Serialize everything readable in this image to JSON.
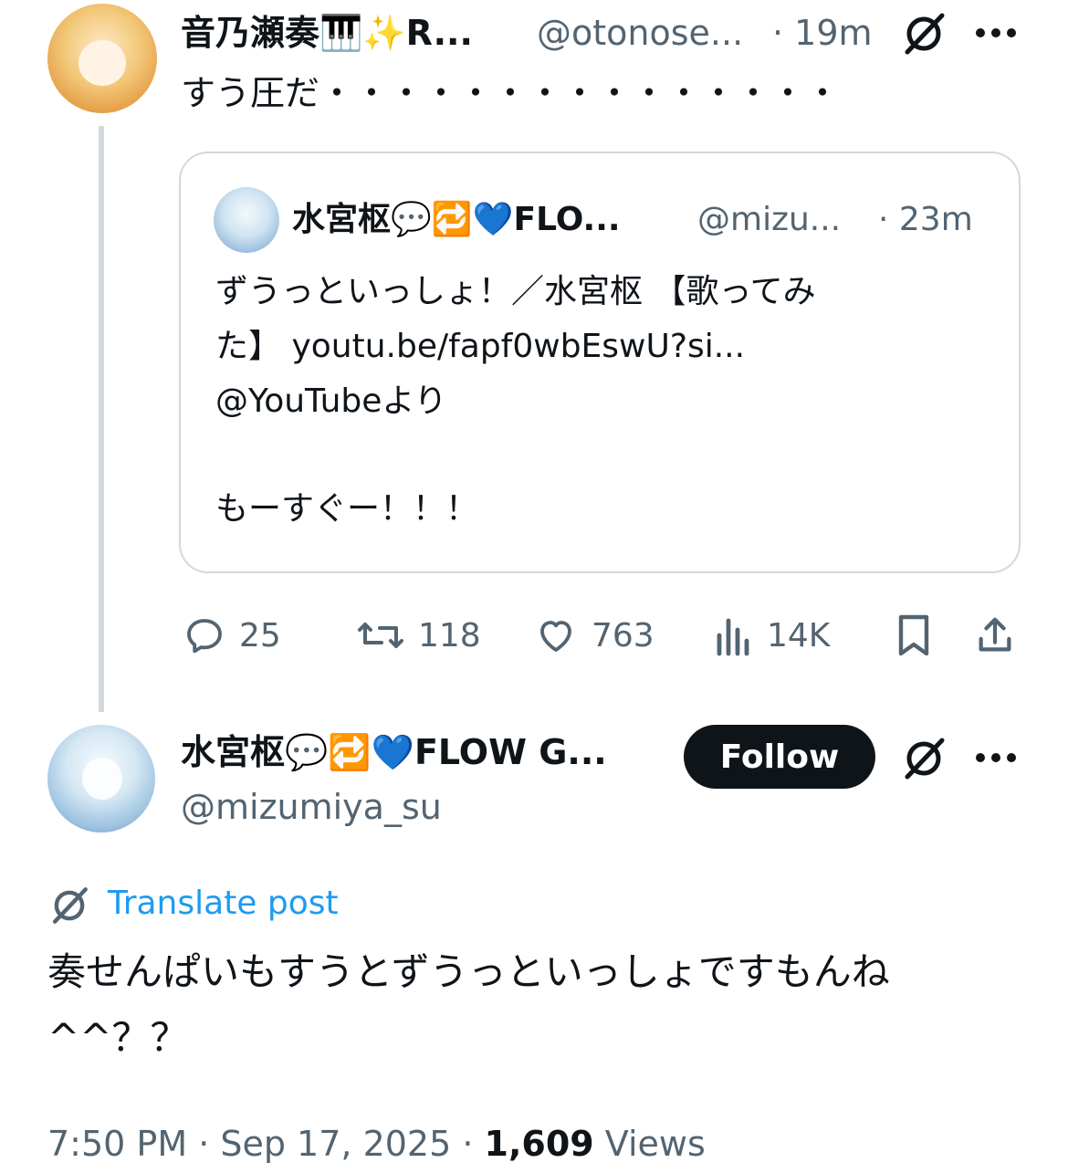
{
  "parent_post": {
    "display_name": "音乃瀬奏🎹✨R...",
    "handle": "@otonose...",
    "time": "· 19m",
    "text": "すう圧だ・・・・・・・・・・・・・・・",
    "quote": {
      "display_name": "水宮枢💬🔁💙FLO...",
      "handle": "@mizu...",
      "time": "· 23m",
      "line1": "ずうっといっしょ！／水宮枢 【歌ってみ",
      "line2": "た】 youtu.be/fapf0wbEswU?si...",
      "line3": "@YouTubeより",
      "line4": "もーすぐー！！！"
    },
    "actions": {
      "replies": "25",
      "reposts": "118",
      "likes": "763",
      "views": "14K"
    }
  },
  "main_post": {
    "display_name": "水宮枢💬🔁💙FLOW G...",
    "handle": "@mizumiya_su",
    "follow_label": "Follow",
    "translate_label": "Translate post",
    "text_line1": "奏せんぱいもすうとずうっといっしょですもんね",
    "text_line2": "^^？？",
    "timestamp": "7:50 PM · Sep 17, 2025 · ",
    "views_count": "1,609",
    "views_label": " Views"
  },
  "colors": {
    "link": "#1d9bf0",
    "gray": "#536471",
    "follow_bg": "#0f1419",
    "border": "#cfd9de"
  }
}
